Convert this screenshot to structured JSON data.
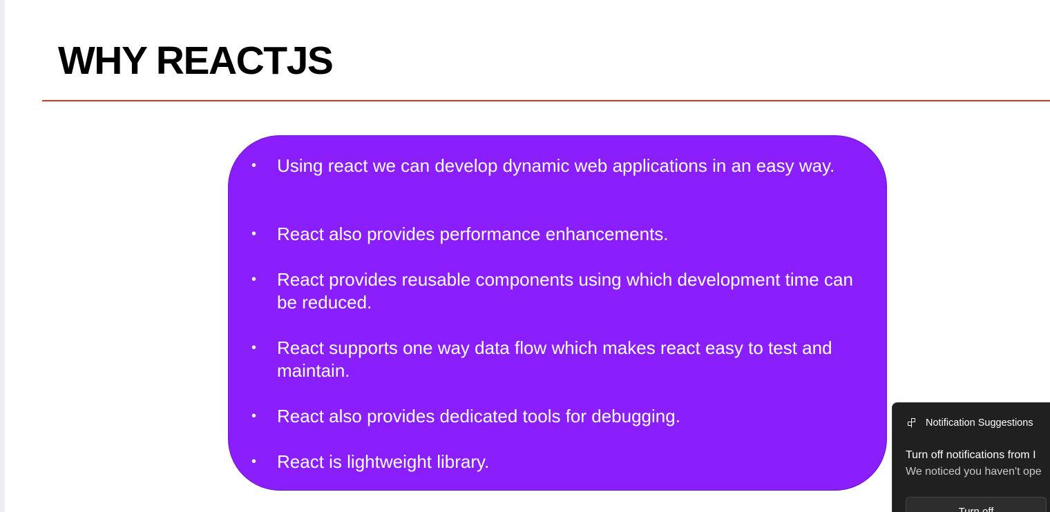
{
  "slide": {
    "title": "WHY REACTJS",
    "colors": {
      "rule": "#d7331d",
      "bubble_fill": "#8a1efc",
      "bullet_text": "#ffffff"
    },
    "bullets": [
      {
        "marker": "•",
        "text": "Using react we can develop dynamic web applications in an easy way."
      },
      {
        "marker": "•",
        "text": "React also provides performance enhancements."
      },
      {
        "marker": "•",
        "text": "React provides reusable components using which development time can be reduced."
      },
      {
        "marker": "•",
        "text": "React supports one way data flow which makes react easy to test and maintain."
      },
      {
        "marker": "•",
        "text": "React also provides dedicated tools for debugging."
      },
      {
        "marker": "•",
        "text": "React is lightweight library."
      }
    ]
  },
  "notification": {
    "app_icon": "notification-suggestions-icon",
    "app_name": "Notification Suggestions",
    "title": "Turn off notifications from I",
    "body": "We noticed you haven't ope",
    "button_label": "Turn off",
    "colors": {
      "background": "#202020",
      "text": "#ffffff"
    }
  }
}
